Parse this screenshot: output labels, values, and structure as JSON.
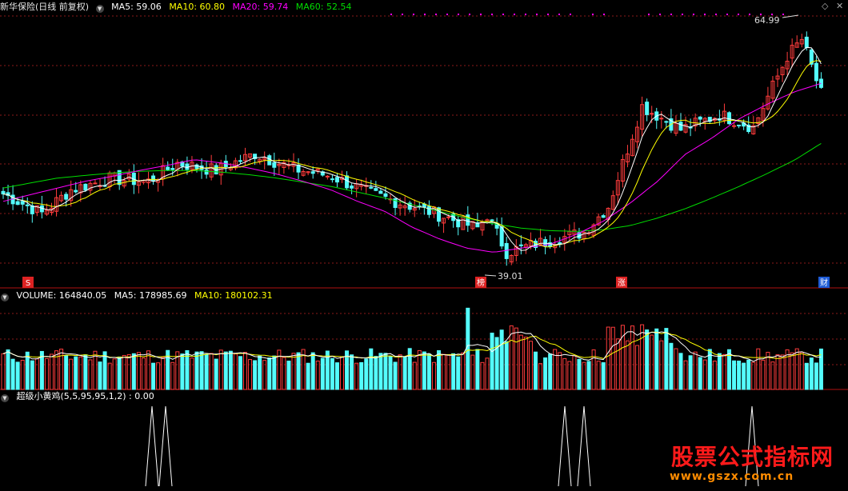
{
  "colors": {
    "up": "#ff3c3c",
    "down": "#54fcfc",
    "ma5": "#ffffff",
    "ma10": "#ffff00",
    "ma20": "#ff00ff",
    "ma60": "#00dd00",
    "grid": "#8b1a1a",
    "separator": "#b01010",
    "label_gray": "#c8c8c8"
  },
  "price_panel": {
    "title": "新华保险(日线 前复权)",
    "ma5_label": "MA5: 59.06",
    "ma10_label": "MA10: 60.80",
    "ma20_label": "MA20: 59.74",
    "ma60_label": "MA60: 52.54",
    "high_label": "64.99",
    "low_label": "39.01",
    "markers": [
      "S",
      "榜",
      "涨",
      "财"
    ]
  },
  "volume_panel": {
    "volume_label": "VOLUME: 164840.05",
    "ma5_label": "MA5: 178985.69",
    "ma10_label": "MA10: 180102.31"
  },
  "indicator_panel": {
    "label": "超级小黄鸡(5,5,95,95,1,2) : 0.00"
  },
  "watermark": {
    "text": "股票公式指标网",
    "url": "www.gszx.com.cn"
  },
  "chart_data": {
    "type": "candlestick",
    "period": "daily",
    "high": 64.99,
    "low": 39.01,
    "ma_last": {
      "MA5": 59.06,
      "MA10": 60.8,
      "MA20": 59.74,
      "MA60": 52.54
    },
    "ma_series": {
      "MA60": [
        47.2,
        47.8,
        48.4,
        48.7,
        49.0,
        49.2,
        49.3,
        49.3,
        49.1,
        48.8,
        48.4,
        47.9,
        47.4,
        46.7,
        46.0,
        45.2,
        44.4,
        43.6,
        42.9,
        42.4,
        42.1,
        42.0,
        42.2,
        42.7,
        43.6,
        44.7,
        46.0,
        47.4,
        48.9,
        50.5,
        52.54
      ],
      "MA20": [
        45.6,
        46.4,
        47.2,
        48.0,
        48.6,
        49.3,
        49.9,
        50.6,
        50.2,
        49.6,
        48.9,
        48.0,
        47.0,
        45.6,
        44.4,
        42.5,
        41.1,
        40.0,
        39.5,
        40.0,
        40.4,
        41.6,
        43.2,
        45.4,
        48.0,
        51.2,
        53.2,
        55.5,
        57.2,
        58.7,
        59.74
      ]
    },
    "volume_last": {
      "VOLUME": 164840.05,
      "MA5": 178985.69,
      "MA10": 180102.31
    },
    "indicator": {
      "name": "超级小黄鸡",
      "params": [
        5,
        5,
        95,
        95,
        1,
        2
      ],
      "last": 0.0
    }
  }
}
